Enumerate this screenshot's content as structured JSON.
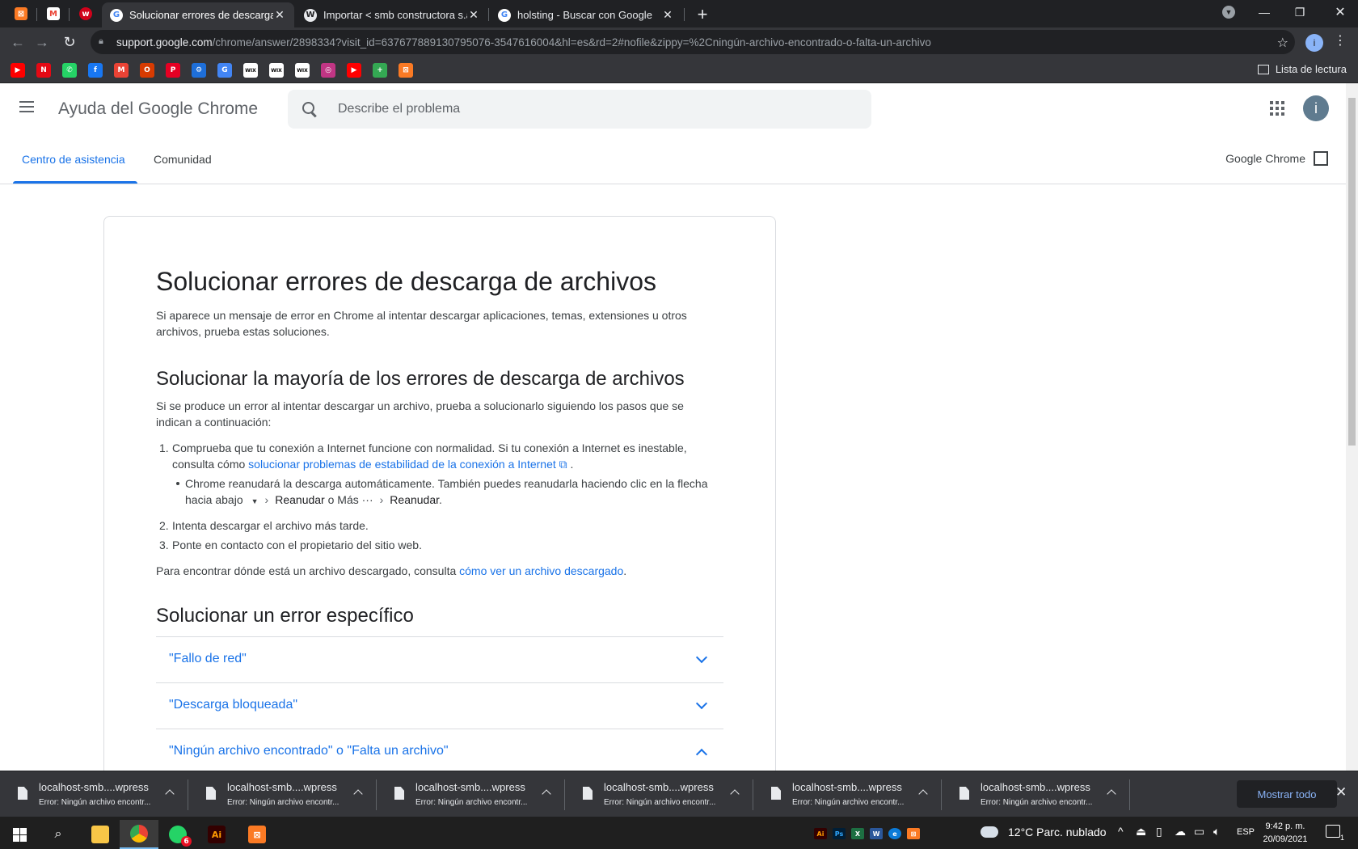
{
  "browser": {
    "pinned_tabs": [
      {
        "icon": "xampp-icon",
        "color": "#fb7a24",
        "glyph": "⊠"
      },
      {
        "icon": "gmail-icon",
        "color": "#ea4335",
        "glyph": "M"
      },
      {
        "icon": "wordpress-red-icon",
        "color": "#d0021b",
        "glyph": "w"
      }
    ],
    "tabs": [
      {
        "title": "Solucionar errores de descarga d",
        "icon": "google-icon",
        "active": true
      },
      {
        "title": "Importar < smb constructora s.a.",
        "icon": "wordpress-icon",
        "active": false
      },
      {
        "title": "holsting - Buscar con Google",
        "icon": "google-icon",
        "active": false
      }
    ],
    "url_host": "support.google.com",
    "url_path": "/chrome/answer/2898334?visit_id=637677889130795076-3547616004&hl=es&rd=2#nofile&zippy=%2Cningún-archivo-encontrado-o-falta-un-archivo",
    "profile_initial": "i",
    "reading_list": "Lista de lectura",
    "bookmarks": [
      {
        "icon": "youtube-icon",
        "color": "#ff0000",
        "glyph": "▶"
      },
      {
        "icon": "netflix-icon",
        "color": "#e50914",
        "glyph": "N"
      },
      {
        "icon": "whatsapp-icon",
        "color": "#25d366",
        "glyph": "✆"
      },
      {
        "icon": "facebook-icon",
        "color": "#1877f2",
        "glyph": "f"
      },
      {
        "icon": "gmail-icon",
        "color": "#ea4335",
        "glyph": "M"
      },
      {
        "icon": "office-icon",
        "color": "#d83b01",
        "glyph": "O"
      },
      {
        "icon": "pinterest-icon",
        "color": "#e60023",
        "glyph": "P"
      },
      {
        "icon": "edge-bookmark-icon",
        "color": "#1e6fd9",
        "glyph": "⚙"
      },
      {
        "icon": "translate-icon",
        "color": "#4285f4",
        "glyph": "G"
      },
      {
        "icon": "wix-icon",
        "color": "#ffffff",
        "glyph": "WIX"
      },
      {
        "icon": "wix-icon",
        "color": "#ffffff",
        "glyph": "WIX"
      },
      {
        "icon": "wix-icon",
        "color": "#ffffff",
        "glyph": "WIX"
      },
      {
        "icon": "instagram-icon",
        "color": "#c13584",
        "glyph": "◎"
      },
      {
        "icon": "youtube-icon",
        "color": "#ff0000",
        "glyph": "▶"
      },
      {
        "icon": "plus-app-icon",
        "color": "#34a853",
        "glyph": "+"
      },
      {
        "icon": "xampp-icon",
        "color": "#fb7a24",
        "glyph": "⊠"
      }
    ]
  },
  "site": {
    "title": "Ayuda del Google Chrome",
    "search_placeholder": "Describe el problema",
    "avatar_initial": "i",
    "nav": {
      "help_center": "Centro de asistencia",
      "community": "Comunidad",
      "product_link": "Google Chrome"
    }
  },
  "article": {
    "title": "Solucionar errores de descarga de archivos",
    "intro": "Si aparece un mensaje de error en Chrome al intentar descargar aplicaciones, temas, extensiones u otros archivos, prueba estas soluciones.",
    "section1": {
      "heading": "Solucionar la mayoría de los errores de descarga de archivos",
      "intro": "Si se produce un error al intentar descargar un archivo, prueba a solucionarlo siguiendo los pasos que se indican a continuación:",
      "step1_prefix": "Comprueba que tu conexión a Internet funcione con normalidad. Si tu conexión a Internet es inestable, consulta cómo ",
      "step1_link": "solucionar problemas de estabilidad de la conexión a Internet",
      "step1_suffix": " .",
      "bullet_line1": "Chrome reanudará la descarga automáticamente. También puedes reanudarla haciendo clic en la flecha",
      "bullet_line2_a": "hacia abajo",
      "bullet_line2_b": "Reanudar",
      "bullet_line2_c": " o Más ",
      "bullet_line2_d": "Reanudar",
      "bullet_line2_e": ".",
      "step2": "Intenta descargar el archivo más tarde.",
      "step3": "Ponte en contacto con el propietario del sitio web.",
      "find_prefix": "Para encontrar dónde está un archivo descargado, consulta ",
      "find_link": "cómo ver un archivo descargado",
      "find_suffix": "."
    },
    "section2": {
      "heading": "Solucionar un error específico",
      "accordions": [
        {
          "label": "\"Fallo de red\"",
          "expanded": false
        },
        {
          "label": "\"Descarga bloqueada\"",
          "expanded": false
        },
        {
          "label": "\"Ningún archivo encontrado\" o \"Falta un archivo\"",
          "expanded": true
        }
      ]
    }
  },
  "downloads": {
    "items": [
      {
        "name": "localhost-smb....wpress",
        "status": "Error: Ningún archivo encontr..."
      },
      {
        "name": "localhost-smb....wpress",
        "status": "Error: Ningún archivo encontr..."
      },
      {
        "name": "localhost-smb....wpress",
        "status": "Error: Ningún archivo encontr..."
      },
      {
        "name": "localhost-smb....wpress",
        "status": "Error: Ningún archivo encontr..."
      },
      {
        "name": "localhost-smb....wpress",
        "status": "Error: Ningún archivo encontr..."
      },
      {
        "name": "localhost-smb....wpress",
        "status": "Error: Ningún archivo encontr..."
      }
    ],
    "show_all": "Mostrar todo"
  },
  "taskbar": {
    "whatsapp_badge": "6",
    "weather": "12°C  Parc. nublado",
    "lang": "ESP",
    "time": "9:42 p. m.",
    "date": "20/09/2021",
    "notif_count": "1"
  }
}
